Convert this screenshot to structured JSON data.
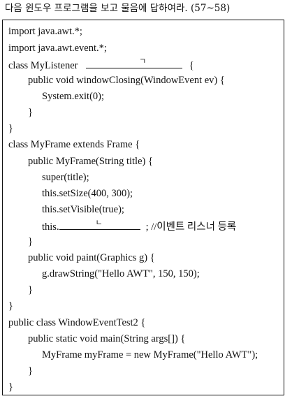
{
  "question": "다음 윈도우 프로그램을 보고 물음에 답하여라. (57~58)",
  "code": {
    "line1": "import java.awt.*;",
    "line2": "import java.awt.event.*;",
    "line3_pre": "class MyListener",
    "line3_blank": "ㄱ",
    "line3_post": "{",
    "line4": "public void windowClosing(WindowEvent ev) {",
    "line5": "System.exit(0);",
    "line6": "}",
    "line7": "}",
    "line8": "class MyFrame extends Frame {",
    "line9": "public MyFrame(String title) {",
    "line10": "super(title);",
    "line11": "this.setSize(400, 300);",
    "line12": "this.setVisible(true);",
    "line13_pre": "this.",
    "line13_blank": "ㄴ",
    "line13_post": "; //이벤트 리스너 등록",
    "line14": "}",
    "line15": "public void paint(Graphics g) {",
    "line16": "g.drawString(\"Hello AWT\", 150, 150);",
    "line17": "}",
    "line18": "}",
    "line19": "public class WindowEventTest2 {",
    "line20": "public static void main(String args[]) {",
    "line21": "MyFrame myFrame = new MyFrame(\"Hello AWT\");",
    "line22": "}",
    "line23": "}"
  }
}
